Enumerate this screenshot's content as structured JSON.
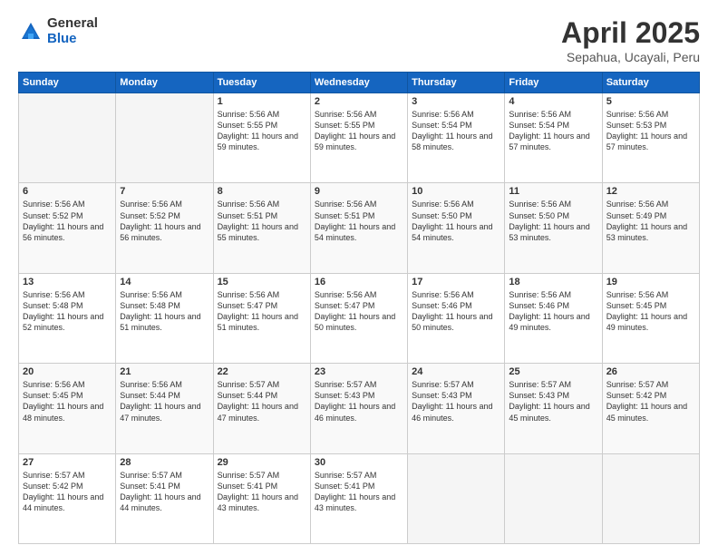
{
  "header": {
    "logo_general": "General",
    "logo_blue": "Blue",
    "title": "April 2025",
    "location": "Sepahua, Ucayali, Peru"
  },
  "weekdays": [
    "Sunday",
    "Monday",
    "Tuesday",
    "Wednesday",
    "Thursday",
    "Friday",
    "Saturday"
  ],
  "weeks": [
    [
      {
        "day": "",
        "sunrise": "",
        "sunset": "",
        "daylight": ""
      },
      {
        "day": "",
        "sunrise": "",
        "sunset": "",
        "daylight": ""
      },
      {
        "day": "1",
        "sunrise": "Sunrise: 5:56 AM",
        "sunset": "Sunset: 5:55 PM",
        "daylight": "Daylight: 11 hours and 59 minutes."
      },
      {
        "day": "2",
        "sunrise": "Sunrise: 5:56 AM",
        "sunset": "Sunset: 5:55 PM",
        "daylight": "Daylight: 11 hours and 59 minutes."
      },
      {
        "day": "3",
        "sunrise": "Sunrise: 5:56 AM",
        "sunset": "Sunset: 5:54 PM",
        "daylight": "Daylight: 11 hours and 58 minutes."
      },
      {
        "day": "4",
        "sunrise": "Sunrise: 5:56 AM",
        "sunset": "Sunset: 5:54 PM",
        "daylight": "Daylight: 11 hours and 57 minutes."
      },
      {
        "day": "5",
        "sunrise": "Sunrise: 5:56 AM",
        "sunset": "Sunset: 5:53 PM",
        "daylight": "Daylight: 11 hours and 57 minutes."
      }
    ],
    [
      {
        "day": "6",
        "sunrise": "Sunrise: 5:56 AM",
        "sunset": "Sunset: 5:52 PM",
        "daylight": "Daylight: 11 hours and 56 minutes."
      },
      {
        "day": "7",
        "sunrise": "Sunrise: 5:56 AM",
        "sunset": "Sunset: 5:52 PM",
        "daylight": "Daylight: 11 hours and 56 minutes."
      },
      {
        "day": "8",
        "sunrise": "Sunrise: 5:56 AM",
        "sunset": "Sunset: 5:51 PM",
        "daylight": "Daylight: 11 hours and 55 minutes."
      },
      {
        "day": "9",
        "sunrise": "Sunrise: 5:56 AM",
        "sunset": "Sunset: 5:51 PM",
        "daylight": "Daylight: 11 hours and 54 minutes."
      },
      {
        "day": "10",
        "sunrise": "Sunrise: 5:56 AM",
        "sunset": "Sunset: 5:50 PM",
        "daylight": "Daylight: 11 hours and 54 minutes."
      },
      {
        "day": "11",
        "sunrise": "Sunrise: 5:56 AM",
        "sunset": "Sunset: 5:50 PM",
        "daylight": "Daylight: 11 hours and 53 minutes."
      },
      {
        "day": "12",
        "sunrise": "Sunrise: 5:56 AM",
        "sunset": "Sunset: 5:49 PM",
        "daylight": "Daylight: 11 hours and 53 minutes."
      }
    ],
    [
      {
        "day": "13",
        "sunrise": "Sunrise: 5:56 AM",
        "sunset": "Sunset: 5:48 PM",
        "daylight": "Daylight: 11 hours and 52 minutes."
      },
      {
        "day": "14",
        "sunrise": "Sunrise: 5:56 AM",
        "sunset": "Sunset: 5:48 PM",
        "daylight": "Daylight: 11 hours and 51 minutes."
      },
      {
        "day": "15",
        "sunrise": "Sunrise: 5:56 AM",
        "sunset": "Sunset: 5:47 PM",
        "daylight": "Daylight: 11 hours and 51 minutes."
      },
      {
        "day": "16",
        "sunrise": "Sunrise: 5:56 AM",
        "sunset": "Sunset: 5:47 PM",
        "daylight": "Daylight: 11 hours and 50 minutes."
      },
      {
        "day": "17",
        "sunrise": "Sunrise: 5:56 AM",
        "sunset": "Sunset: 5:46 PM",
        "daylight": "Daylight: 11 hours and 50 minutes."
      },
      {
        "day": "18",
        "sunrise": "Sunrise: 5:56 AM",
        "sunset": "Sunset: 5:46 PM",
        "daylight": "Daylight: 11 hours and 49 minutes."
      },
      {
        "day": "19",
        "sunrise": "Sunrise: 5:56 AM",
        "sunset": "Sunset: 5:45 PM",
        "daylight": "Daylight: 11 hours and 49 minutes."
      }
    ],
    [
      {
        "day": "20",
        "sunrise": "Sunrise: 5:56 AM",
        "sunset": "Sunset: 5:45 PM",
        "daylight": "Daylight: 11 hours and 48 minutes."
      },
      {
        "day": "21",
        "sunrise": "Sunrise: 5:56 AM",
        "sunset": "Sunset: 5:44 PM",
        "daylight": "Daylight: 11 hours and 47 minutes."
      },
      {
        "day": "22",
        "sunrise": "Sunrise: 5:57 AM",
        "sunset": "Sunset: 5:44 PM",
        "daylight": "Daylight: 11 hours and 47 minutes."
      },
      {
        "day": "23",
        "sunrise": "Sunrise: 5:57 AM",
        "sunset": "Sunset: 5:43 PM",
        "daylight": "Daylight: 11 hours and 46 minutes."
      },
      {
        "day": "24",
        "sunrise": "Sunrise: 5:57 AM",
        "sunset": "Sunset: 5:43 PM",
        "daylight": "Daylight: 11 hours and 46 minutes."
      },
      {
        "day": "25",
        "sunrise": "Sunrise: 5:57 AM",
        "sunset": "Sunset: 5:43 PM",
        "daylight": "Daylight: 11 hours and 45 minutes."
      },
      {
        "day": "26",
        "sunrise": "Sunrise: 5:57 AM",
        "sunset": "Sunset: 5:42 PM",
        "daylight": "Daylight: 11 hours and 45 minutes."
      }
    ],
    [
      {
        "day": "27",
        "sunrise": "Sunrise: 5:57 AM",
        "sunset": "Sunset: 5:42 PM",
        "daylight": "Daylight: 11 hours and 44 minutes."
      },
      {
        "day": "28",
        "sunrise": "Sunrise: 5:57 AM",
        "sunset": "Sunset: 5:41 PM",
        "daylight": "Daylight: 11 hours and 44 minutes."
      },
      {
        "day": "29",
        "sunrise": "Sunrise: 5:57 AM",
        "sunset": "Sunset: 5:41 PM",
        "daylight": "Daylight: 11 hours and 43 minutes."
      },
      {
        "day": "30",
        "sunrise": "Sunrise: 5:57 AM",
        "sunset": "Sunset: 5:41 PM",
        "daylight": "Daylight: 11 hours and 43 minutes."
      },
      {
        "day": "",
        "sunrise": "",
        "sunset": "",
        "daylight": ""
      },
      {
        "day": "",
        "sunrise": "",
        "sunset": "",
        "daylight": ""
      },
      {
        "day": "",
        "sunrise": "",
        "sunset": "",
        "daylight": ""
      }
    ]
  ]
}
